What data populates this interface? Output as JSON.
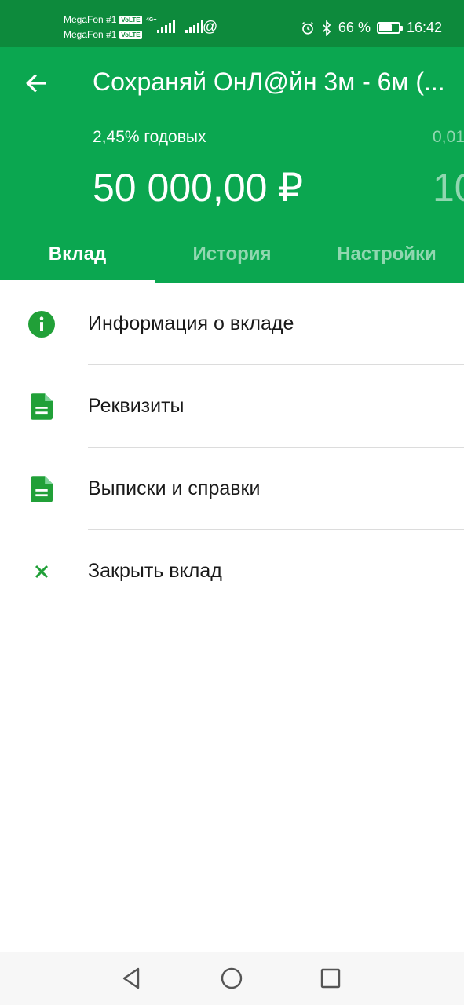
{
  "status_bar": {
    "carrier1": "MegaFon #1",
    "carrier2": "MegaFon #1",
    "volte": "VoLTE",
    "network": "4G+",
    "battery_percent": "66 %",
    "battery_level": 0.66,
    "time": "16:42",
    "icons": [
      "alarm-icon",
      "bluetooth-icon",
      "battery-icon",
      "signal-icon",
      "at-icon"
    ]
  },
  "header": {
    "title": "Сохраняй ОнЛ@йн 3м - 6м (...",
    "rate": "2,45% годовых",
    "rate_next": "0,01",
    "amount": "50 000,00 ₽",
    "amount_next": "10",
    "back_icon": "arrow-left-icon"
  },
  "tabs": [
    {
      "label": "Вклад",
      "active": true
    },
    {
      "label": "История",
      "active": false
    },
    {
      "label": "Настройки",
      "active": false
    }
  ],
  "menu": [
    {
      "label": "Информация о вкладе",
      "icon": "info-icon"
    },
    {
      "label": "Реквизиты",
      "icon": "document-icon"
    },
    {
      "label": "Выписки и справки",
      "icon": "document-icon"
    },
    {
      "label": "Закрыть вклад",
      "icon": "close-icon"
    }
  ],
  "colors": {
    "status_bar": "#0d8a3c",
    "header": "#0ba750",
    "accent": "#21a038"
  },
  "nav": [
    "back-nav-icon",
    "home-nav-icon",
    "recents-nav-icon"
  ]
}
